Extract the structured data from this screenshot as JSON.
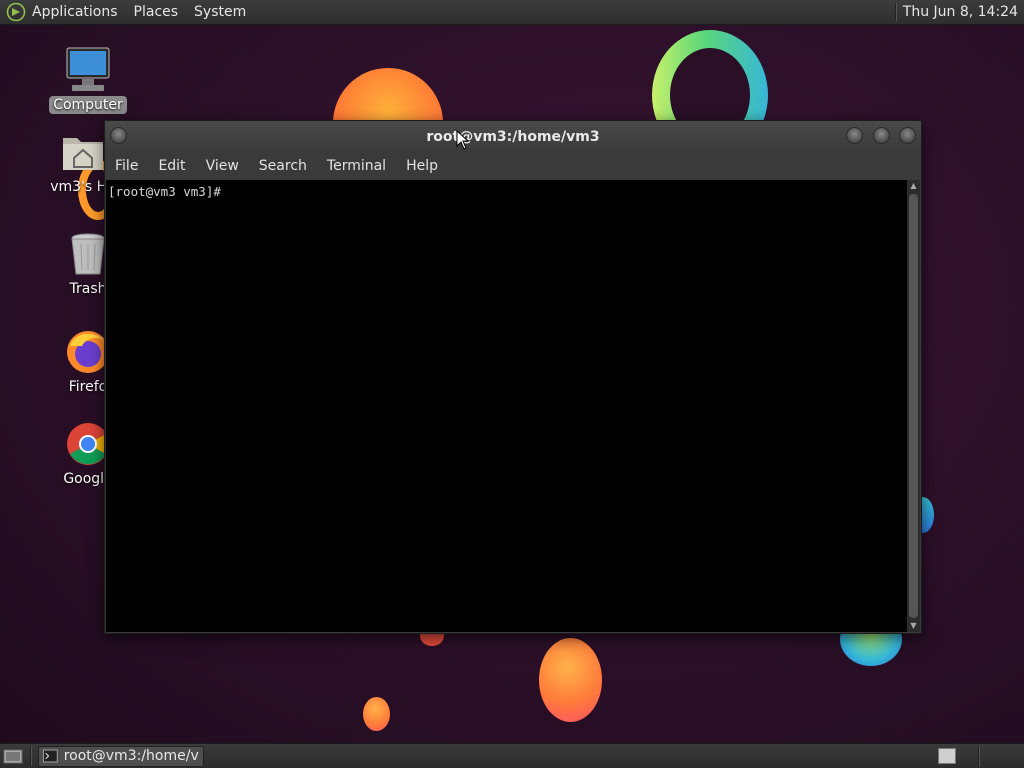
{
  "top_panel": {
    "menus": [
      "Applications",
      "Places",
      "System"
    ],
    "clock": "Thu Jun  8, 14:24"
  },
  "desktop_icons": [
    {
      "label": "Computer",
      "icon": "computer-icon"
    },
    {
      "label": "vm3's Ho",
      "icon": "home-folder-icon"
    },
    {
      "label": "Trash",
      "icon": "trash-icon"
    },
    {
      "label": "Firefo",
      "icon": "firefox-icon"
    },
    {
      "label": "Google",
      "icon": "chrome-icon"
    }
  ],
  "terminal": {
    "title": "root@vm3:/home/vm3",
    "menus": [
      "File",
      "Edit",
      "View",
      "Search",
      "Terminal",
      "Help"
    ],
    "prompt": "[root@vm3 vm3]# "
  },
  "taskbar": {
    "task_label": "root@vm3:/home/v...",
    "task_icon": "terminal-icon"
  },
  "colors": {
    "wallpaper": "#2a0f27",
    "panel": "#333333",
    "terminal_bg": "#000000"
  }
}
